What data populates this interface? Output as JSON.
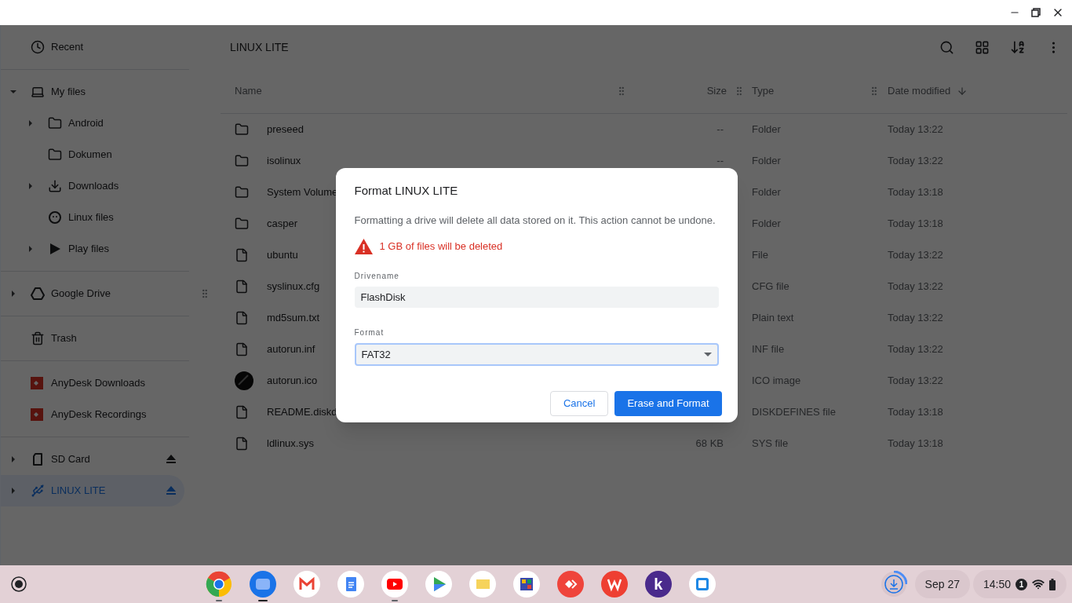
{
  "sidebar": {
    "sections": [
      {
        "items": [
          {
            "kind": "recent",
            "label": "Recent",
            "has_children": false,
            "selected": false,
            "eject": false
          }
        ]
      },
      {
        "items": [
          {
            "kind": "computer",
            "label": "My files",
            "has_children": true,
            "expanded": true,
            "selected": false,
            "eject": false,
            "children": [
              {
                "kind": "folder",
                "label": "Android",
                "has_children": true,
                "expanded": false,
                "selected": false,
                "eject": false
              },
              {
                "kind": "folder",
                "label": "Dokumen",
                "has_children": false,
                "selected": false,
                "eject": false
              },
              {
                "kind": "download",
                "label": "Downloads",
                "has_children": true,
                "expanded": false,
                "selected": false,
                "eject": false
              },
              {
                "kind": "linux",
                "label": "Linux files",
                "has_children": false,
                "selected": false,
                "eject": false
              },
              {
                "kind": "play",
                "label": "Play files",
                "has_children": true,
                "expanded": false,
                "selected": false,
                "eject": false
              }
            ]
          }
        ]
      },
      {
        "items": [
          {
            "kind": "drive",
            "label": "Google Drive",
            "has_children": true,
            "expanded": false,
            "selected": false,
            "eject": false
          }
        ]
      },
      {
        "items": [
          {
            "kind": "trash",
            "label": "Trash",
            "has_children": false,
            "selected": false,
            "eject": false
          }
        ]
      },
      {
        "items": [
          {
            "kind": "remote",
            "label": "AnyDesk Downloads",
            "has_children": false,
            "selected": false,
            "eject": false
          },
          {
            "kind": "remote",
            "label": "AnyDesk Recordings",
            "has_children": false,
            "selected": false,
            "eject": false
          }
        ]
      },
      {
        "items": [
          {
            "kind": "sdcard",
            "label": "SD Card",
            "has_children": true,
            "expanded": false,
            "selected": false,
            "eject": true
          },
          {
            "kind": "usb",
            "label": "LINUX LITE",
            "has_children": true,
            "expanded": false,
            "selected": true,
            "eject": true
          }
        ]
      }
    ]
  },
  "toolbar": {
    "title": "LINUX LITE"
  },
  "table": {
    "columns": [
      {
        "label": "Name",
        "sorted": false
      },
      {
        "label": "Size",
        "sorted": false
      },
      {
        "label": "Type",
        "sorted": false
      },
      {
        "label": "Date modified",
        "sorted": true
      }
    ],
    "rows": [
      {
        "kind": "folder",
        "name": "preseed",
        "size": "--",
        "type": "Folder",
        "date": "Today 13:22"
      },
      {
        "kind": "folder",
        "name": "isolinux",
        "size": "--",
        "type": "Folder",
        "date": "Today 13:22"
      },
      {
        "kind": "folder",
        "name": "System Volume",
        "type": "Folder",
        "date": "Today 13:18"
      },
      {
        "kind": "folder",
        "name": "casper",
        "type": "Folder",
        "date": "Today 13:18"
      },
      {
        "kind": "file",
        "name": "ubuntu",
        "type": "File",
        "date": "Today 13:22"
      },
      {
        "kind": "file",
        "name": "syslinux.cfg",
        "type": "CFG file",
        "date": "Today 13:22"
      },
      {
        "kind": "file",
        "name": "md5sum.txt",
        "type": "Plain text",
        "date": "Today 13:22"
      },
      {
        "kind": "file",
        "name": "autorun.inf",
        "type": "INF file",
        "date": "Today 13:22"
      },
      {
        "kind": "image",
        "name": "autorun.ico",
        "type": "ICO image",
        "date": "Today 13:22"
      },
      {
        "kind": "file",
        "name": "README.diskd",
        "type": "DISKDEFINES file",
        "date": "Today 13:18"
      },
      {
        "kind": "file",
        "name": "ldlinux.sys",
        "size": "68 KB",
        "type": "SYS file",
        "date": "Today 13:18"
      }
    ]
  },
  "dialog": {
    "title": "Format LINUX LITE",
    "message": "Formatting a drive will delete all data stored on it. This action cannot be undone.",
    "warning": "1 GB of files will be deleted",
    "drive_name": {
      "label": "Drivename",
      "value": "FlashDisk"
    },
    "format": {
      "label": "Format",
      "value": "FAT32"
    },
    "buttons": [
      {
        "kind": "secondary",
        "label": "Cancel"
      },
      {
        "kind": "primary",
        "label": "Erase and Format"
      }
    ]
  },
  "shelf": {
    "apps": [
      {
        "kind": "browser",
        "running": true
      },
      {
        "kind": "files",
        "running": true
      },
      {
        "kind": "mail",
        "running": false
      },
      {
        "kind": "docs",
        "running": false
      },
      {
        "kind": "video",
        "running": true
      },
      {
        "kind": "store",
        "running": false
      },
      {
        "kind": "notes",
        "running": false
      },
      {
        "kind": "game",
        "running": false
      },
      {
        "kind": "remote",
        "running": false
      },
      {
        "kind": "office",
        "running": false
      },
      {
        "kind": "letter",
        "running": false,
        "text": "k"
      },
      {
        "kind": "gallery",
        "running": false
      }
    ],
    "date": "Sep 27",
    "time": "14:50",
    "notifications": "1"
  }
}
